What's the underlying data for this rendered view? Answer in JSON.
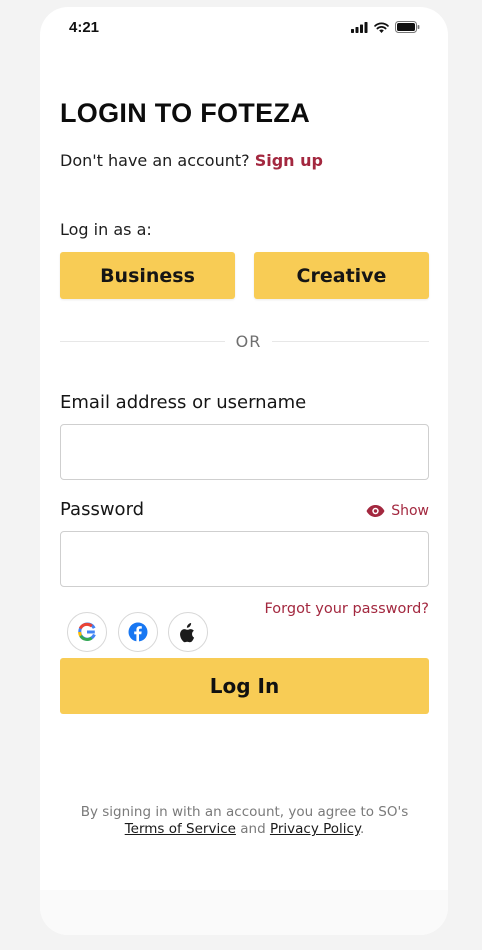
{
  "status_bar": {
    "time": "4:21"
  },
  "login": {
    "title": "LOGIN TO FOTEZA",
    "no_account_text": "Don't have an account?",
    "signup_link": "Sign up",
    "login_as_label": "Log in as a:",
    "roles": [
      "Business",
      "Creative"
    ],
    "or_text": "OR",
    "email_label": "Email address or username",
    "email_value": "",
    "password_label": "Password",
    "password_value": "",
    "show_label": "Show",
    "forgot_link": "Forgot your password?",
    "social_icons": [
      "google-icon",
      "facebook-icon",
      "apple-icon"
    ],
    "login_button": "Log In"
  },
  "legal": {
    "prefix": "By signing in with an account, you agree to SO's",
    "terms": "Terms of Service",
    "and": "and",
    "privacy": "Privacy Policy",
    "period": "."
  },
  "colors": {
    "accent_yellow": "#f8cc55",
    "link_red": "#a3283f",
    "background": "#f3f3f3"
  }
}
